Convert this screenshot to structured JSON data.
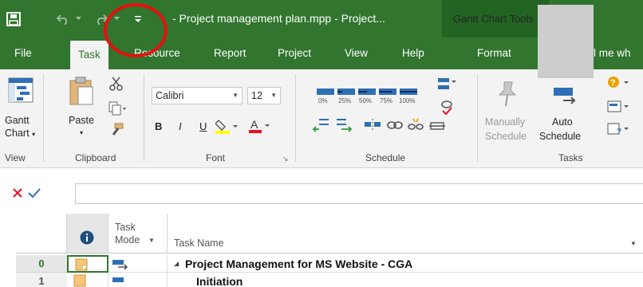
{
  "titlebar": {
    "title": "- Project management plan.mpp  -  Project...",
    "contextual_tab_group": "Gantt Chart Tools"
  },
  "tabs": [
    {
      "label": "File",
      "active": false
    },
    {
      "label": "Task",
      "active": true
    },
    {
      "label": "Resource",
      "active": false
    },
    {
      "label": "Report",
      "active": false
    },
    {
      "label": "Project",
      "active": false
    },
    {
      "label": "View",
      "active": false
    },
    {
      "label": "Help",
      "active": false
    },
    {
      "label": "Format",
      "active": false
    }
  ],
  "tell_me": "Tell me wh",
  "ribbon": {
    "view_group": {
      "label": "View",
      "gantt_label_1": "Gantt",
      "gantt_label_2": "Chart"
    },
    "clipboard_group": {
      "label": "Clipboard",
      "paste_label": "Paste"
    },
    "font_group": {
      "label": "Font",
      "font_name": "Calibri",
      "font_size": "12",
      "bold": "B",
      "italic": "I",
      "underline": "U"
    },
    "schedule_group": {
      "label": "Schedule",
      "percent_buttons": [
        "0%",
        "25%",
        "50%",
        "75%",
        "100%"
      ]
    },
    "tasks_group": {
      "label": "Tasks",
      "manually_1": "Manually",
      "manually_2": "Schedule",
      "auto_1": "Auto",
      "auto_2": "Schedule"
    }
  },
  "colors": {
    "accent": "#31752f",
    "contextual": "#226322",
    "annotation": "#e61010"
  },
  "grid": {
    "headers": {
      "info": "i",
      "task_mode_1": "Task",
      "task_mode_2": "Mode",
      "task_name": "Task Name"
    },
    "rows": [
      {
        "id": "0",
        "task_name": "Project Management for MS Website - CGA"
      },
      {
        "id": "1",
        "task_name": "Initiation"
      }
    ]
  }
}
